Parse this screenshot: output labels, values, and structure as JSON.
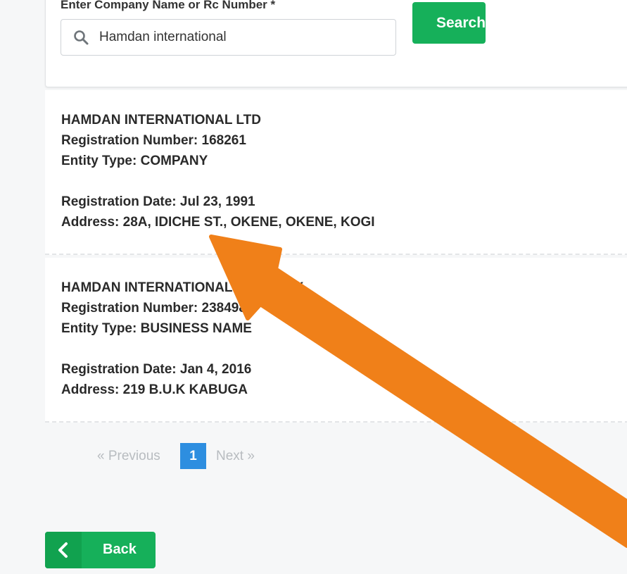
{
  "search": {
    "label": "Enter Company Name or Rc Number *",
    "value": "Hamdan international",
    "button_label": "Search"
  },
  "results": [
    {
      "name": "HAMDAN INTERNATIONAL LTD",
      "registration_number": "Registration Number: 168261",
      "entity_type": "Entity Type: COMPANY",
      "registration_date": "Registration Date: Jul 23, 1991",
      "address": "Address: 28A, IDICHE ST., OKENE, OKENE, KOGI"
    },
    {
      "name": "HAMDAN INTERNATIONAL COMPANY",
      "registration_number": "Registration Number: 2384985",
      "entity_type": "Entity Type: BUSINESS NAME",
      "registration_date": "Registration Date: Jan 4, 2016",
      "address": "Address: 219 B.U.K KABUGA"
    }
  ],
  "pagination": {
    "previous": "« Previous",
    "current": "1",
    "next": "Next »"
  },
  "back": {
    "icon": "chevron-left-icon",
    "label": "Back"
  },
  "colors": {
    "primary_green": "#16b05a",
    "page_blue": "#2d8ee0",
    "arrow_orange": "#f08019"
  }
}
